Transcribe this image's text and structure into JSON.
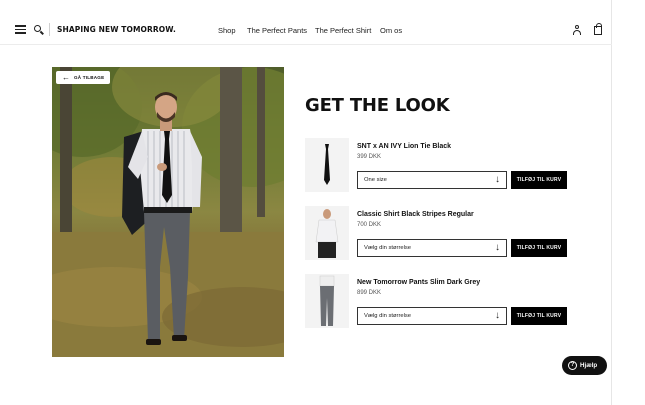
{
  "header": {
    "logo": "SHAPING NEW TOMORROW.",
    "nav": [
      "Shop",
      "The Perfect Pants",
      "The Perfect Shirt",
      "Om os"
    ]
  },
  "hero": {
    "back_label": "GÅ TILBAGE"
  },
  "title": "GET THE LOOK",
  "products": [
    {
      "name": "SNT x AN IVY Lion Tie Black",
      "price": "399 DKK",
      "size": "One size",
      "cart": "TILFØJ TIL KURV"
    },
    {
      "name": "Classic Shirt Black Stripes Regular",
      "price": "700 DKK",
      "size": "Vælg din størrelse",
      "cart": "TILFØJ TIL KURV"
    },
    {
      "name": "New Tomorrow Pants Slim Dark Grey",
      "price": "899 DKK",
      "size": "Vælg din størrelse",
      "cart": "TILFØJ TIL KURV"
    }
  ],
  "help": {
    "label": "Hjælp"
  },
  "colors": {
    "accent": "#000000",
    "background": "#ffffff"
  }
}
